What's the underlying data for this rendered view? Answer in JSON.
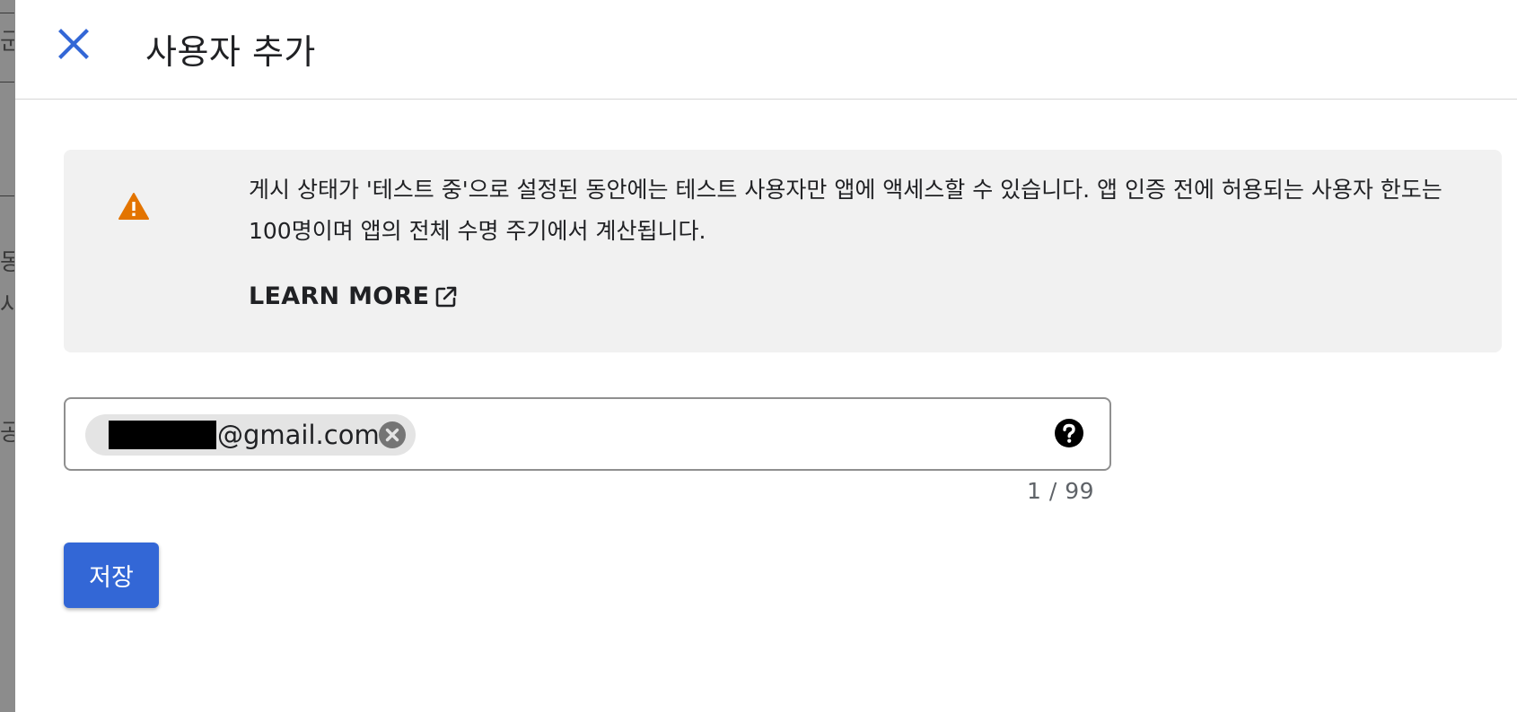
{
  "dialog": {
    "title": "사용자 추가",
    "close_icon": "close-icon"
  },
  "notice": {
    "icon": "warning-icon",
    "text": "게시 상태가 '테스트 중'으로 설정된 동안에는 테스트 사용자만 앱에 액세스할 수 있습니다. 앱 인증 전에 허용되는 사용자 한도는 100명이며 앱의 전체 수명 주기에서 계산됩니다.",
    "learn_more_label": "LEARN MORE",
    "learn_more_icon": "open-in-new-icon"
  },
  "email_input": {
    "chips": [
      {
        "text": "@gmail.com",
        "redacted_prefix": true,
        "remove_icon": "cancel-icon"
      }
    ],
    "help_icon": "help-icon",
    "counter": "1 / 99"
  },
  "actions": {
    "save_label": "저장"
  },
  "background_fragments": [
    "군",
    "동",
    "사",
    "공지"
  ],
  "colors": {
    "primary": "#3367d6",
    "warning": "#e37400",
    "notice_bg": "#f1f1f1",
    "chip_bg": "#e4e4e4"
  }
}
